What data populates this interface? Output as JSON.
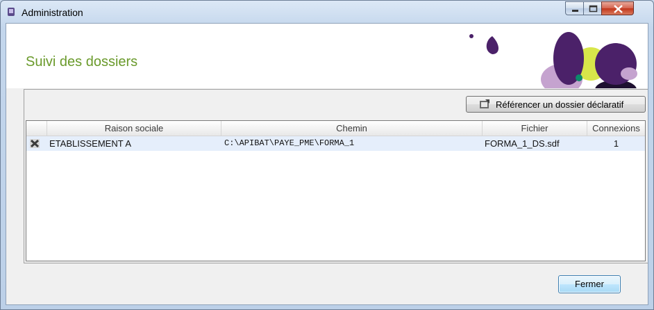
{
  "window": {
    "title": "Administration"
  },
  "header": {
    "page_title": "Suivi des dossiers"
  },
  "toolbar": {
    "reference_button_label": "Référencer un dossier déclaratif"
  },
  "grid": {
    "columns": [
      "Raison sociale",
      "Chemin",
      "Fichier",
      "Connexions"
    ],
    "rows": [
      {
        "raison_sociale": "ETABLISSEMENT A",
        "chemin": "C:\\APIBAT\\PAYE_PME\\FORMA_1",
        "fichier": "FORMA_1_DS.sdf",
        "connexions": "1"
      }
    ]
  },
  "footer": {
    "close_button_label": "Fermer"
  },
  "colors": {
    "title_green": "#6a9a2b",
    "row_selected": "#e5eefb",
    "deco_purple": "#4b2169",
    "deco_lilac": "#c5a3cf",
    "deco_lime": "#d8e64a",
    "deco_teal": "#0c8a6a"
  }
}
